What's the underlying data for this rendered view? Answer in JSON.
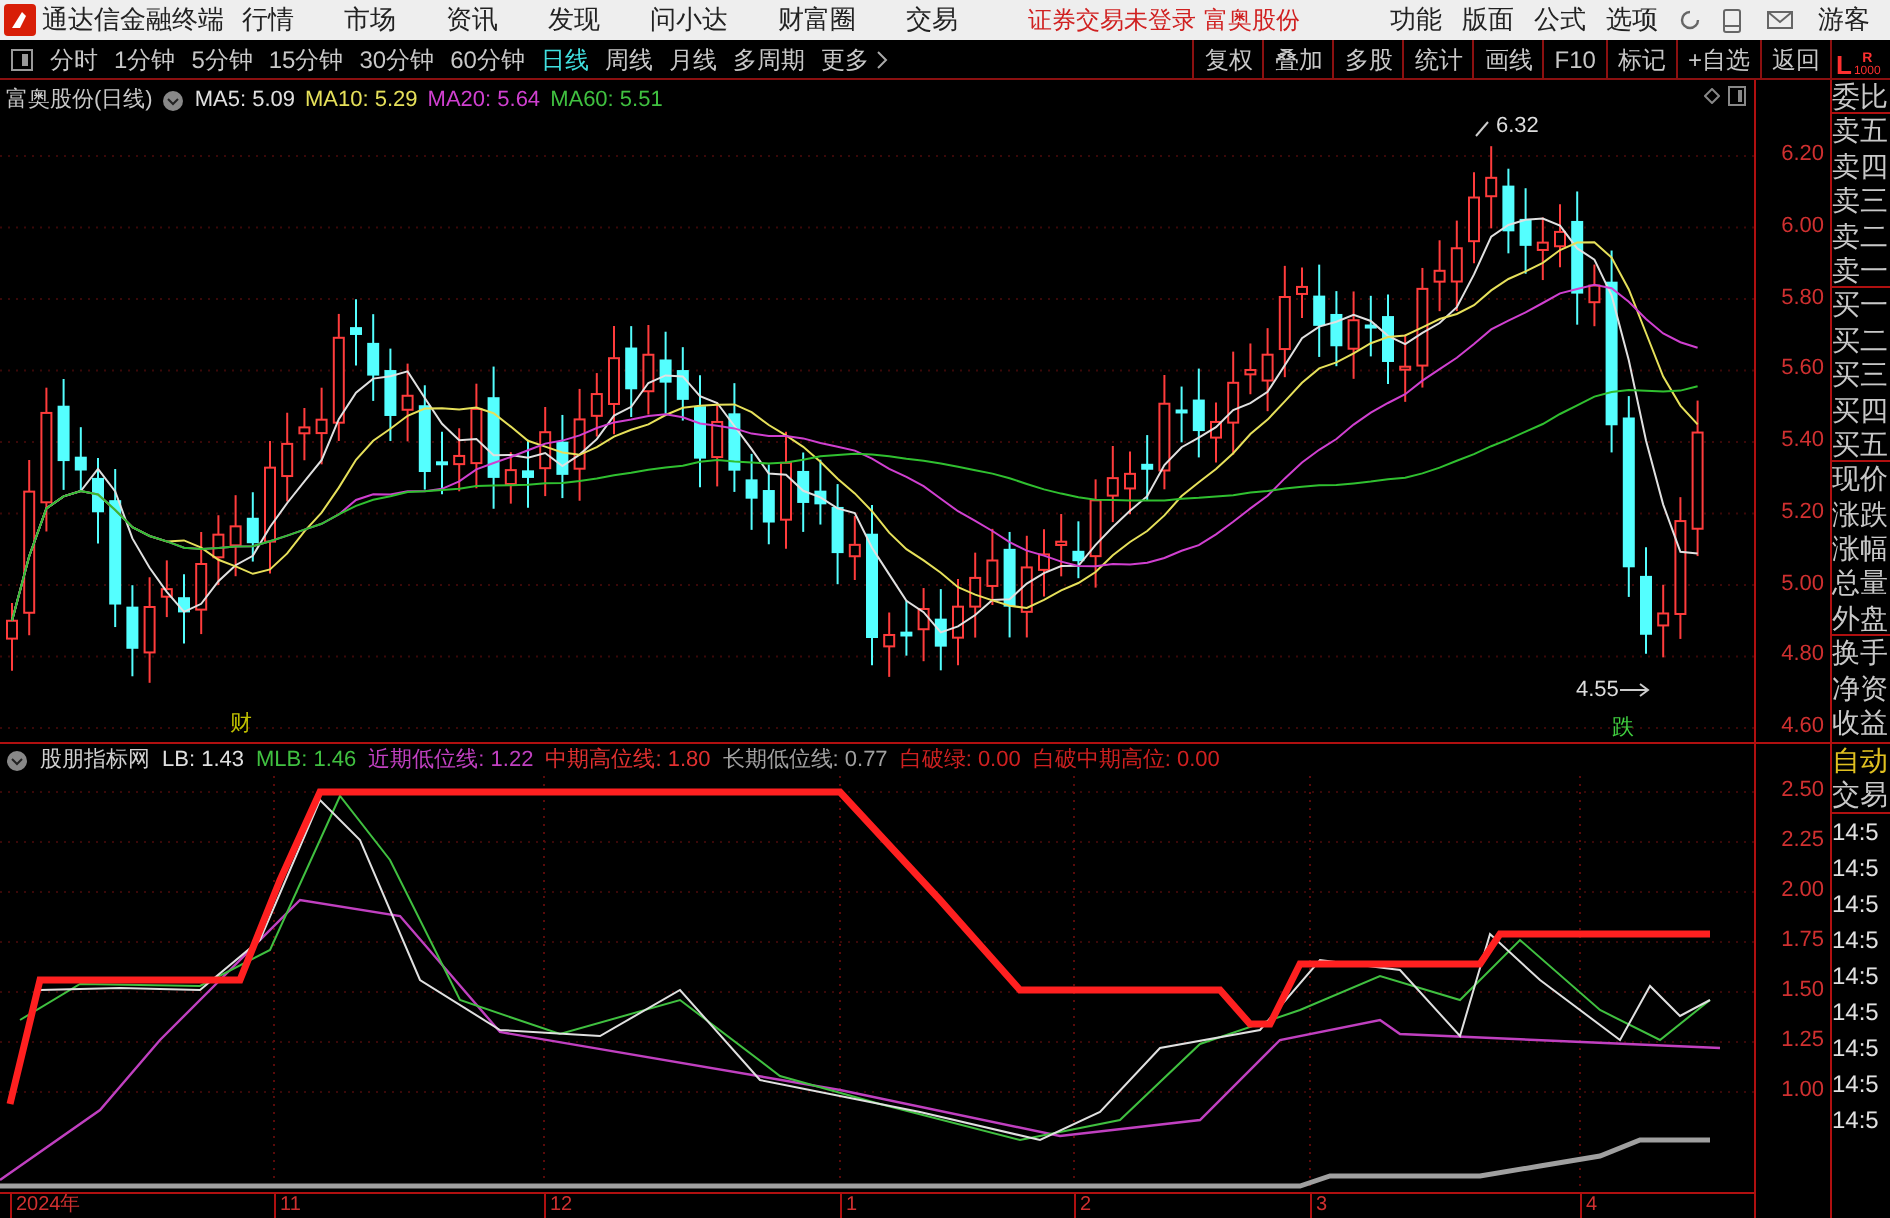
{
  "app": {
    "title": "通达信金融终端"
  },
  "menu": [
    "行情",
    "市场",
    "资讯",
    "发现",
    "问小达",
    "财富圈",
    "交易"
  ],
  "login_notice": "证券交易未登录",
  "stock_link": "富奥股份",
  "right_menu": [
    "功能",
    "版面",
    "公式",
    "选项"
  ],
  "user": "游客",
  "periods": [
    {
      "label": "分时",
      "selected": false
    },
    {
      "label": "1分钟",
      "selected": false
    },
    {
      "label": "5分钟",
      "selected": false
    },
    {
      "label": "15分钟",
      "selected": false
    },
    {
      "label": "30分钟",
      "selected": false
    },
    {
      "label": "60分钟",
      "selected": false
    },
    {
      "label": "日线",
      "selected": true
    },
    {
      "label": "周线",
      "selected": false
    },
    {
      "label": "月线",
      "selected": false
    },
    {
      "label": "多周期",
      "selected": false
    },
    {
      "label": "更多",
      "selected": false
    }
  ],
  "tools": [
    "复权",
    "叠加",
    "多股",
    "统计",
    "画线",
    "F10",
    "标记",
    "+自选",
    "返回"
  ],
  "side_logo": {
    "left": "L",
    "right": "R",
    "sub": "1000"
  },
  "price_chart": {
    "title": "富奥股份(日线)",
    "ma": [
      {
        "label": "MA5:",
        "value": "5.09",
        "color": "#e0e0e0"
      },
      {
        "label": "MA10:",
        "value": "5.29",
        "color": "#e6e05a"
      },
      {
        "label": "MA20:",
        "value": "5.64",
        "color": "#d040d0"
      },
      {
        "label": "MA60:",
        "value": "5.51",
        "color": "#40c040"
      }
    ],
    "axis_labels": [
      "6.20",
      "6.00",
      "5.80",
      "5.60",
      "5.40",
      "5.20",
      "5.00",
      "4.80",
      "4.60"
    ],
    "high_marker": "6.32",
    "low_marker": "4.55",
    "markers": [
      {
        "text": "财",
        "color": "#c0c000"
      },
      {
        "text": "跌",
        "color": "#40d040"
      }
    ]
  },
  "quote_fields": [
    "委比",
    "卖五",
    "卖四",
    "卖三",
    "卖二",
    "卖一",
    "买一",
    "买二",
    "买三",
    "买四",
    "买五",
    "现价",
    "涨跌",
    "涨幅",
    "总量",
    "外盘",
    "换手",
    "净资",
    "收益"
  ],
  "indicator": {
    "name": "股朋指标网",
    "values": [
      {
        "label": "LB:",
        "value": "1.43",
        "color": "#e0e0e0"
      },
      {
        "label": "MLB:",
        "value": "1.46",
        "color": "#40c040"
      },
      {
        "label": "近期低位线:",
        "value": "1.22",
        "color": "#c040c0"
      },
      {
        "label": "中期高位线:",
        "value": "1.80",
        "color": "#e03030"
      },
      {
        "label": "长期低位线:",
        "value": "0.77",
        "color": "#a0a0a0"
      },
      {
        "label": "白破绿:",
        "value": "0.00",
        "color": "#d02020"
      },
      {
        "label": "白破中期高位:",
        "value": "0.00",
        "color": "#d02020"
      }
    ],
    "axis_labels": [
      "2.50",
      "2.25",
      "2.00",
      "1.75",
      "1.50",
      "1.25",
      "1.00"
    ]
  },
  "trade": {
    "mode": "自动",
    "title": "交易",
    "times": [
      "14:5",
      "14:5",
      "14:5",
      "14:5",
      "14:5",
      "14:5",
      "14:5",
      "14:5",
      "14:5"
    ]
  },
  "date_axis": [
    "2024年",
    "11",
    "12",
    "1",
    "2",
    "3",
    "4"
  ]
}
